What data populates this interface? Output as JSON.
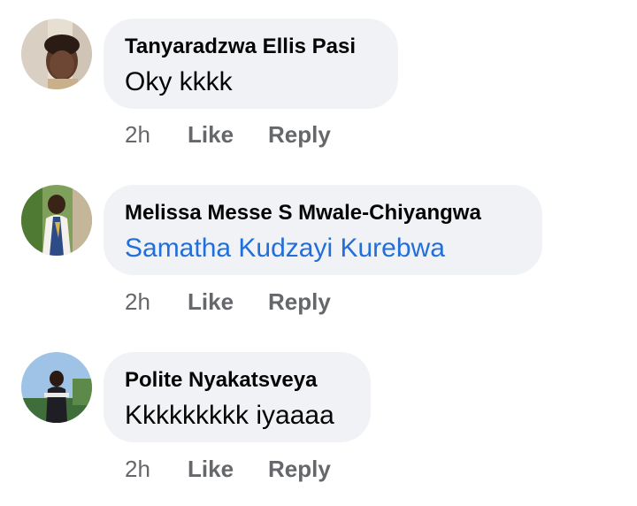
{
  "comments": [
    {
      "author": "Tanyaradzwa Ellis Pasi",
      "text": "Oky kkkk",
      "mention": false,
      "time": "2h",
      "like_label": "Like",
      "reply_label": "Reply"
    },
    {
      "author": "Melissa Messe S Mwale-Chiyangwa",
      "text": "Samatha Kudzayi Kurebwa",
      "mention": true,
      "time": "2h",
      "like_label": "Like",
      "reply_label": "Reply"
    },
    {
      "author": "Polite Nyakatsveya",
      "text": "Kkkkkkkkk iyaaaa",
      "mention": false,
      "time": "2h",
      "like_label": "Like",
      "reply_label": "Reply"
    }
  ],
  "colors": {
    "bubble": "#f0f2f5",
    "mention": "#216fdb",
    "meta": "#65676b"
  }
}
